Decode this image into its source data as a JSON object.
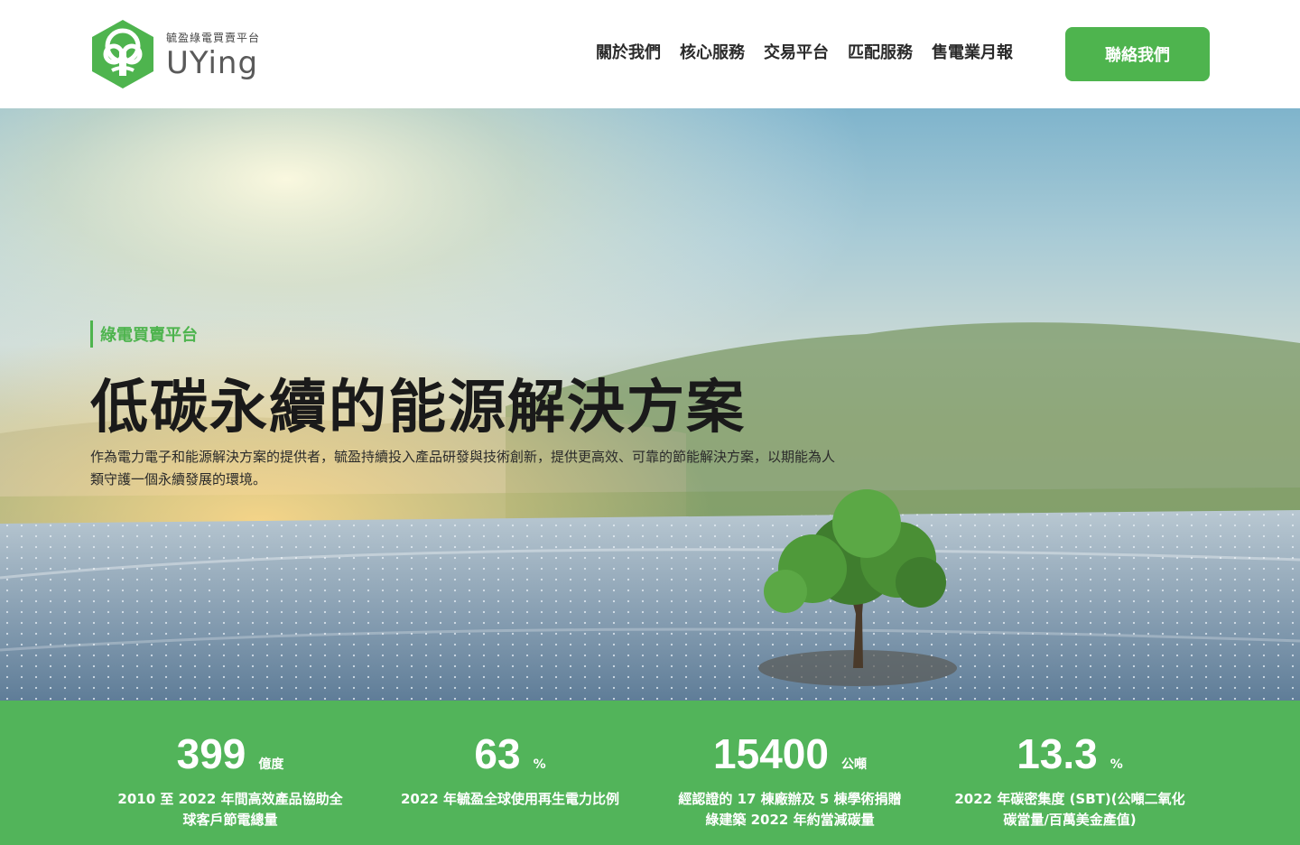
{
  "header": {
    "logo_sub": "毓盈綠電買賣平台",
    "logo_main": "UYing",
    "nav": [
      "關於我們",
      "核心服務",
      "交易平台",
      "匹配服務",
      "售電業月報"
    ],
    "contact_label": "聯絡我們"
  },
  "hero": {
    "tag": "綠電買賣平台",
    "title": "低碳永續的能源解決方案",
    "description": "作為電力電子和能源解決方案的提供者，毓盈持續投入產品研發與技術創新，提供更高效、可靠的節能解決方案，以期能為人類守護一個永續發展的環境。"
  },
  "stats": [
    {
      "value": "399",
      "unit": "億度",
      "label": "2010 至 2022 年間高效產品協助全球客戶節電總量"
    },
    {
      "value": "63",
      "unit": "%",
      "label": "2022 年毓盈全球使用再生電力比例"
    },
    {
      "value": "15400",
      "unit": "公噸",
      "label": "經認證的 17 棟廠辦及 5 棟學術捐贈綠建築 2022 年約當減碳量"
    },
    {
      "value": "13.3",
      "unit": "%",
      "label": "2022 年碳密集度 (SBT)(公噸二氧化碳當量/百萬美金產值)"
    }
  ],
  "colors": {
    "brand_green": "#4eb44e",
    "stats_bg": "#52b45a"
  }
}
